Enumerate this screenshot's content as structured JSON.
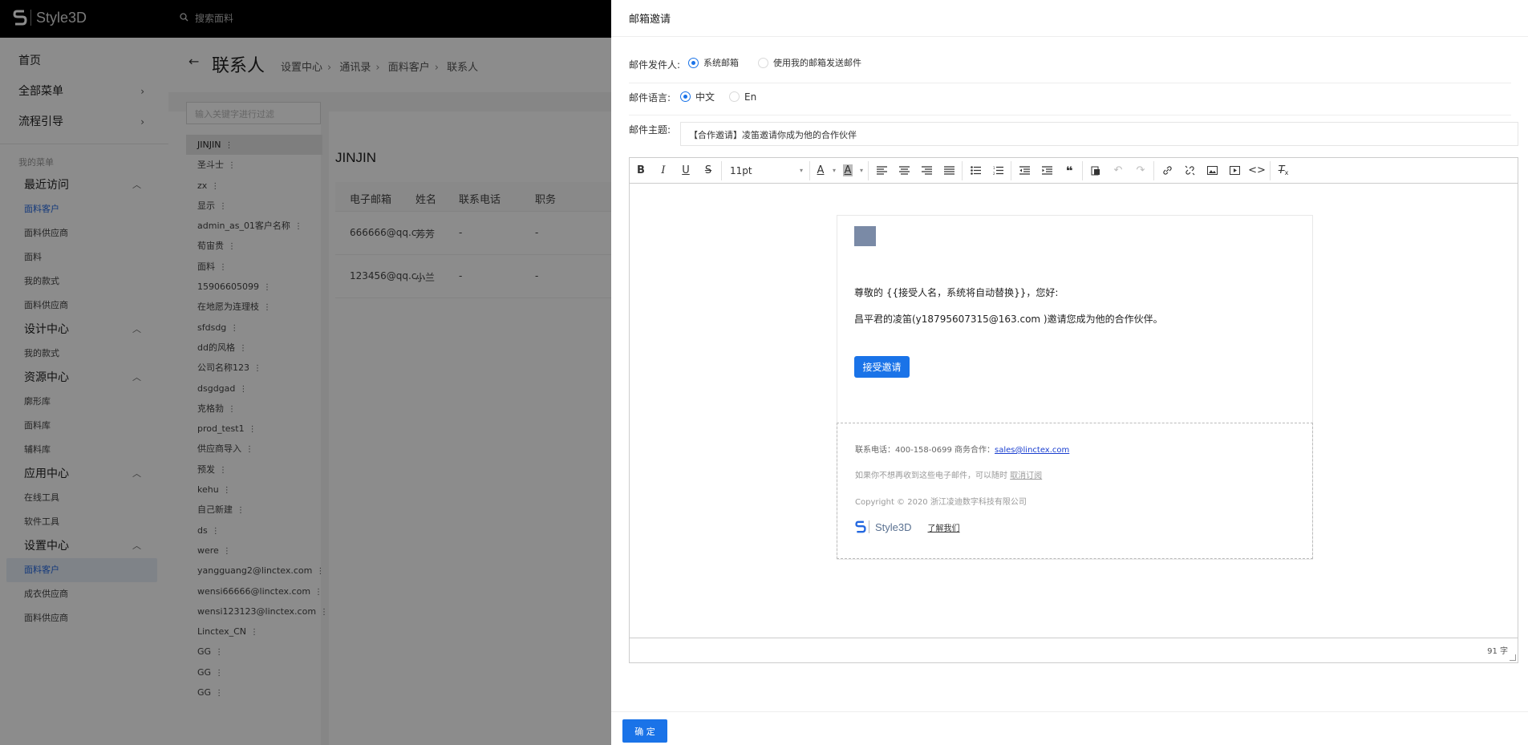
{
  "app": {
    "brand": "Style3D",
    "search_placeholder": "搜索面料"
  },
  "sidebar": {
    "top": [
      {
        "label": "首页"
      },
      {
        "label": "全部菜单",
        "chevron": "›"
      },
      {
        "label": "流程引导",
        "chevron": "›"
      }
    ],
    "my_menu": "我的菜单",
    "groups": [
      {
        "label": "最近访问",
        "items": [
          "面料客户",
          "面料供应商",
          "面料",
          "我的款式",
          "面料供应商"
        ]
      },
      {
        "label": "设计中心",
        "items": [
          "我的款式"
        ]
      },
      {
        "label": "资源中心",
        "items": [
          "廓形库",
          "面料库",
          "辅料库"
        ]
      },
      {
        "label": "应用中心",
        "items": [
          "在线工具",
          "软件工具"
        ]
      },
      {
        "label": "设置中心",
        "items": [
          "面料客户",
          "成衣供应商",
          "面料供应商"
        ]
      }
    ]
  },
  "main": {
    "back": "←",
    "title": "联系人",
    "breadcrumb": [
      "设置中心",
      "通讯录",
      "面料客户",
      "联系人"
    ],
    "filter_placeholder": "输入关键字进行过滤",
    "customers": [
      "JINJIN",
      "圣斗士",
      "zx",
      "显示",
      "admin_as_01客户名称",
      "荀宙贵",
      "面料",
      "15906605099",
      "在地愿为连理枝",
      "sfdsdg",
      "dd的风格",
      "公司名称123",
      "dsgdgad",
      "克格勃",
      "prod_test1",
      "供应商导入",
      "预发",
      "kehu",
      "自己新建",
      "ds",
      "were",
      "yangguang2@linctex.com",
      "wensi66666@linctex.com",
      "wensi123123@linctex.com",
      "Linctex_CN",
      "GG",
      "GG",
      "GG"
    ],
    "detail_name": "JINJIN",
    "table": {
      "headers": [
        "电子邮箱",
        "姓名",
        "联系电话",
        "职务"
      ],
      "rows": [
        [
          "666666@qq.c...",
          "芳芳",
          "-",
          "-"
        ],
        [
          "123456@qq.c...",
          "小兰",
          "-",
          "-"
        ]
      ]
    }
  },
  "drawer": {
    "title": "邮箱邀请",
    "sender_label": "邮件发件人:",
    "sender_options": [
      "系统邮箱",
      "使用我的邮箱发送邮件"
    ],
    "lang_label": "邮件语言:",
    "lang_options": [
      "中文",
      "En"
    ],
    "subject_label": "邮件主题:",
    "subject_value": "【合作邀请】凌笛邀请你成为他的合作伙伴",
    "font_size": "11pt",
    "email": {
      "greeting": "尊敬的 {{接受人名，系统将自动替换}}，您好:",
      "invite": "昌平君的凌笛(y18795607315@163.com )邀请您成为他的合作伙伴。",
      "accept_button": "接受邀请",
      "contact_prefix": "联系电话：400-158-0699 商务合作：",
      "contact_email": "sales@linctex.com",
      "unsub_prefix": "如果你不想再收到这些电子邮件，可以随时 ",
      "unsub_link": "取消订阅",
      "copyright": "Copyright © 2020 浙江凌迪数字科技有限公司",
      "footer_brand": "Style3D",
      "about": "了解我们"
    },
    "word_count": "91 字",
    "ok_button": "确 定"
  },
  "colors": {
    "accent": "#1a73e8",
    "topbar": "#000000",
    "avatar": "#7a8aa6"
  }
}
